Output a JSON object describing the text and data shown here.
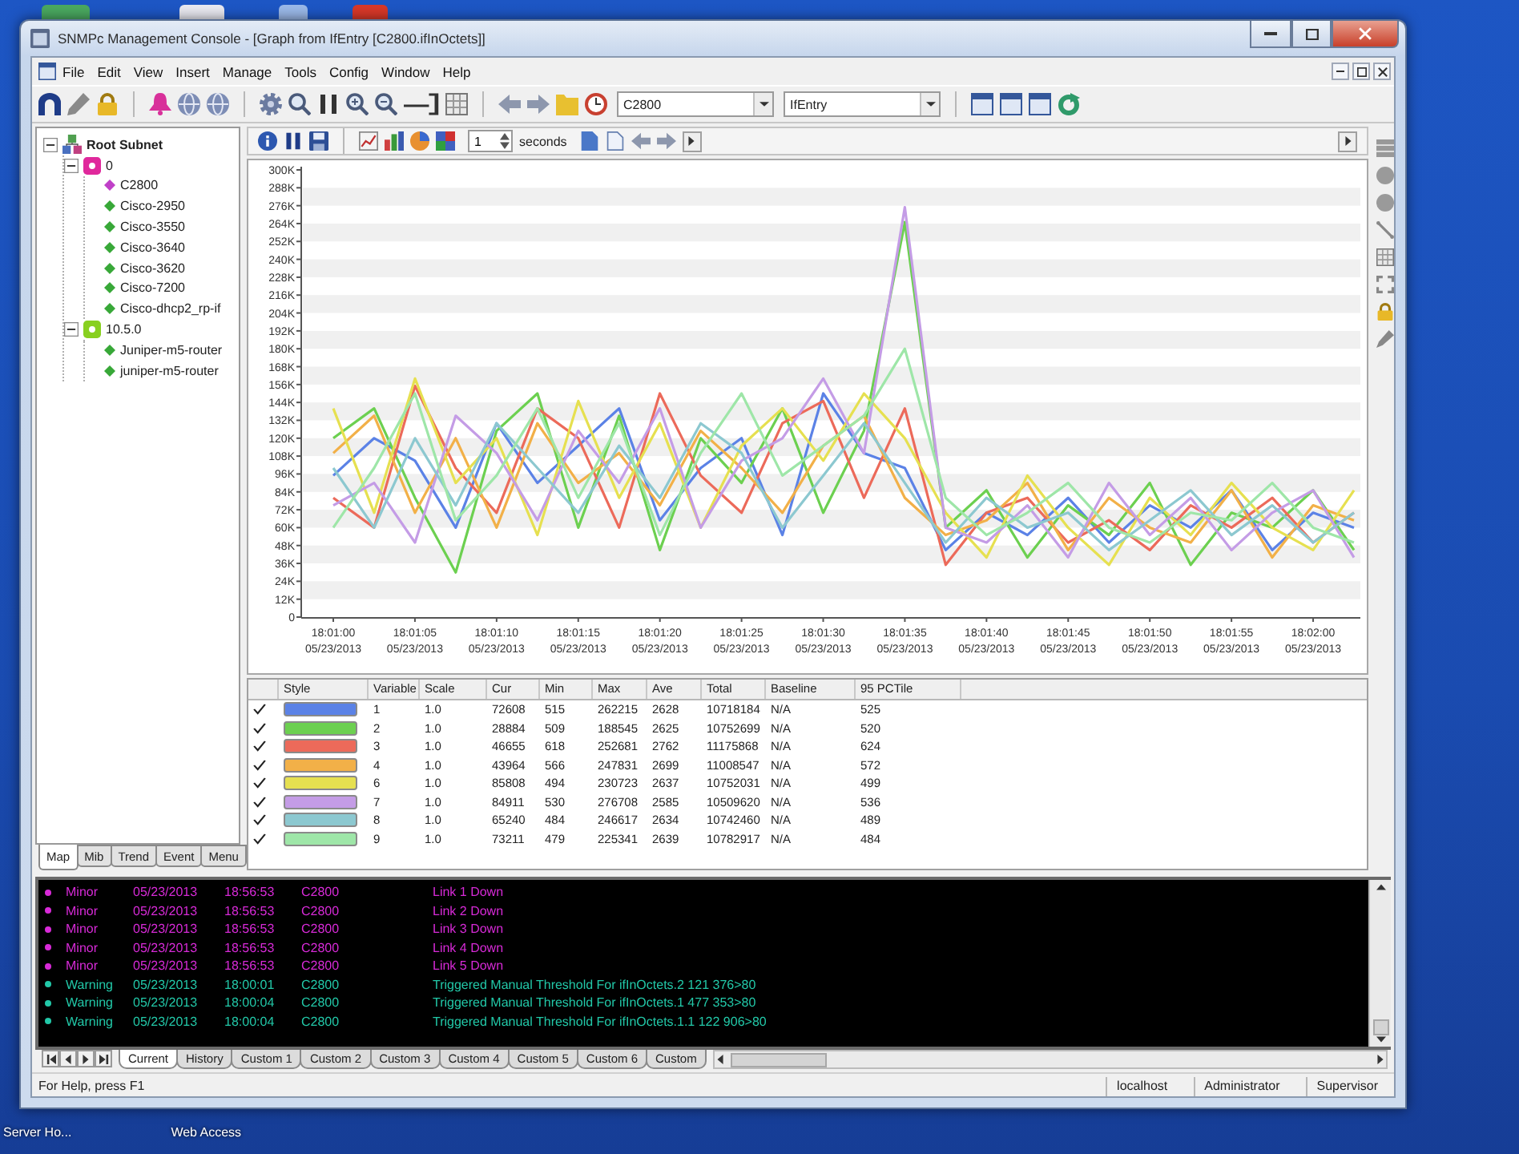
{
  "window": {
    "title": "SNMPc Management Console - [Graph from IfEntry [C2800.ifInOctets]]"
  },
  "menu": [
    "File",
    "Edit",
    "View",
    "Insert",
    "Manage",
    "Tools",
    "Config",
    "Window",
    "Help"
  ],
  "toolbar": {
    "device_combo": "C2800",
    "mib_combo": "IfEntry"
  },
  "tree": {
    "items": [
      {
        "label": "Root Subnet",
        "expanded": true,
        "children": [
          {
            "label": "0",
            "color": "#e0289c",
            "expanded": true,
            "children": [
              {
                "label": "C2800",
                "color": "#c040c8"
              },
              {
                "label": "Cisco-2950",
                "color": "#38a838"
              },
              {
                "label": "Cisco-3550",
                "color": "#38a838"
              },
              {
                "label": "Cisco-3640",
                "color": "#38a838"
              },
              {
                "label": "Cisco-3620",
                "color": "#38a838"
              },
              {
                "label": "Cisco-7200",
                "color": "#38a838"
              },
              {
                "label": "Cisco-dhcp2_rp-if",
                "color": "#38a838"
              }
            ]
          },
          {
            "label": "10.5.0",
            "color": "#88d020",
            "expanded": true,
            "children": [
              {
                "label": "Juniper-m5-router",
                "color": "#38a838"
              },
              {
                "label": "juniper-m5-router",
                "color": "#38a838"
              }
            ]
          }
        ]
      }
    ]
  },
  "left_tabs": [
    {
      "label": "Map",
      "selected": true
    },
    {
      "label": "Mib",
      "selected": false
    },
    {
      "label": "Trend",
      "selected": false
    },
    {
      "label": "Event",
      "selected": false
    },
    {
      "label": "Menu",
      "selected": false
    }
  ],
  "graph": {
    "interval": {
      "value": "1",
      "unit": "seconds"
    },
    "chart_data": {
      "type": "line",
      "ylim": [
        0,
        300
      ],
      "categories": [
        "18:01:00\n05/23/2013",
        null,
        "18:01:05\n05/23/2013",
        null,
        "18:01:10\n05/23/2013",
        null,
        "18:01:15\n05/23/2013",
        null,
        "18:01:20\n05/23/2013",
        null,
        "18:01:25\n05/23/2013",
        null,
        "18:01:30\n05/23/2013",
        null,
        "18:01:35\n05/23/2013",
        null,
        "18:01:40\n05/23/2013",
        null,
        "18:01:45\n05/23/2013",
        null,
        "18:01:50\n05/23/2013",
        null,
        "18:01:55\n05/23/2013",
        null,
        "18:02:00\n05/23/2013",
        null
      ],
      "yticks": [
        0,
        {
          "value": 12,
          "label": "12K"
        },
        {
          "value": 24,
          "label": "24K"
        },
        {
          "value": 36,
          "label": "36K"
        },
        {
          "value": 48,
          "label": "48K"
        },
        {
          "value": 60,
          "label": "60K"
        },
        {
          "value": 72,
          "label": "72K"
        },
        {
          "value": 84,
          "label": "84K"
        },
        {
          "value": 96,
          "label": "96K"
        },
        {
          "value": 108,
          "label": "108K"
        },
        {
          "value": 120,
          "label": "120K"
        },
        {
          "value": 132,
          "label": "132K"
        },
        {
          "value": 144,
          "label": "144K"
        },
        {
          "value": 156,
          "label": "156K"
        },
        {
          "value": 168,
          "label": "168K"
        },
        {
          "value": 180,
          "label": "180K"
        },
        {
          "value": 192,
          "label": "192K"
        },
        {
          "value": 204,
          "label": "204K"
        },
        {
          "value": 216,
          "label": "216K"
        },
        {
          "value": 228,
          "label": "228K"
        },
        {
          "value": 240,
          "label": "240K"
        },
        {
          "value": 252,
          "label": "252K"
        },
        {
          "value": 264,
          "label": "264K"
        },
        {
          "value": 276,
          "label": "276K"
        },
        {
          "value": 288,
          "label": "288K"
        },
        {
          "value": 300,
          "label": "300K"
        }
      ],
      "series": [
        {
          "color": "#5b82e6",
          "values": [
            95,
            120,
            105,
            60,
            130,
            90,
            115,
            140,
            65,
            100,
            120,
            55,
            150,
            110,
            100,
            45,
            70,
            55,
            80,
            50,
            75,
            60,
            85,
            45,
            70,
            60
          ]
        },
        {
          "color": "#6cd050",
          "values": [
            120,
            140,
            80,
            30,
            125,
            150,
            60,
            135,
            45,
            120,
            90,
            140,
            70,
            125,
            265,
            60,
            85,
            40,
            75,
            55,
            90,
            35,
            70,
            60,
            85,
            45
          ]
        },
        {
          "color": "#ec6a5a",
          "values": [
            80,
            60,
            155,
            100,
            70,
            140,
            120,
            60,
            150,
            95,
            70,
            130,
            145,
            80,
            140,
            35,
            70,
            80,
            50,
            65,
            45,
            75,
            60,
            80,
            50,
            70
          ]
        },
        {
          "color": "#f2b048",
          "values": [
            110,
            135,
            70,
            120,
            60,
            130,
            90,
            110,
            75,
            125,
            100,
            70,
            115,
            135,
            80,
            55,
            65,
            90,
            45,
            80,
            60,
            50,
            85,
            40,
            75,
            65
          ]
        },
        {
          "color": "#e6e050",
          "values": [
            140,
            70,
            160,
            90,
            120,
            55,
            145,
            80,
            130,
            60,
            115,
            140,
            105,
            150,
            120,
            70,
            40,
            95,
            60,
            35,
            80,
            55,
            90,
            60,
            45,
            85
          ]
        },
        {
          "color": "#c49ce6",
          "values": [
            75,
            90,
            50,
            135,
            110,
            65,
            125,
            90,
            140,
            60,
            105,
            120,
            160,
            110,
            275,
            60,
            50,
            75,
            40,
            90,
            55,
            80,
            45,
            70,
            85,
            40
          ]
        },
        {
          "color": "#8cc8d0",
          "values": [
            100,
            60,
            120,
            75,
            130,
            100,
            70,
            115,
            80,
            130,
            110,
            60,
            95,
            130,
            90,
            50,
            80,
            60,
            70,
            45,
            65,
            85,
            55,
            75,
            50,
            70
          ]
        },
        {
          "color": "#9ee6a8",
          "values": [
            60,
            100,
            150,
            65,
            95,
            140,
            80,
            130,
            55,
            110,
            150,
            95,
            115,
            135,
            180,
            80,
            55,
            70,
            90,
            60,
            50,
            70,
            65,
            90,
            60,
            50
          ]
        }
      ]
    }
  },
  "variables_table": {
    "columns": [
      "Style",
      "Variable",
      "Scale",
      "Cur",
      "Min",
      "Max",
      "Ave",
      "Total",
      "Baseline",
      "95 PCTile"
    ],
    "rows": [
      {
        "checked": true,
        "color": "#5b82e6",
        "variable": "1",
        "scale": "1.0",
        "cur": "72608",
        "min": "515",
        "max": "262215",
        "ave": "2628",
        "total": "10718184",
        "baseline": "N/A",
        "pctile": "525"
      },
      {
        "checked": true,
        "color": "#6cd050",
        "variable": "2",
        "scale": "1.0",
        "cur": "28884",
        "min": "509",
        "max": "188545",
        "ave": "2625",
        "total": "10752699",
        "baseline": "N/A",
        "pctile": "520"
      },
      {
        "checked": true,
        "color": "#ec6a5a",
        "variable": "3",
        "scale": "1.0",
        "cur": "46655",
        "min": "618",
        "max": "252681",
        "ave": "2762",
        "total": "11175868",
        "baseline": "N/A",
        "pctile": "624"
      },
      {
        "checked": true,
        "color": "#f2b048",
        "variable": "4",
        "scale": "1.0",
        "cur": "43964",
        "min": "566",
        "max": "247831",
        "ave": "2699",
        "total": "11008547",
        "baseline": "N/A",
        "pctile": "572"
      },
      {
        "checked": true,
        "color": "#e6e050",
        "variable": "6",
        "scale": "1.0",
        "cur": "85808",
        "min": "494",
        "max": "230723",
        "ave": "2637",
        "total": "10752031",
        "baseline": "N/A",
        "pctile": "499"
      },
      {
        "checked": true,
        "color": "#c49ce6",
        "variable": "7",
        "scale": "1.0",
        "cur": "84911",
        "min": "530",
        "max": "276708",
        "ave": "2585",
        "total": "10509620",
        "baseline": "N/A",
        "pctile": "536"
      },
      {
        "checked": true,
        "color": "#8cc8d0",
        "variable": "8",
        "scale": "1.0",
        "cur": "65240",
        "min": "484",
        "max": "246617",
        "ave": "2634",
        "total": "10742460",
        "baseline": "N/A",
        "pctile": "489"
      },
      {
        "checked": true,
        "color": "#9ee6a8",
        "variable": "9",
        "scale": "1.0",
        "cur": "73211",
        "min": "479",
        "max": "225341",
        "ave": "2639",
        "total": "10782917",
        "baseline": "N/A",
        "pctile": "484"
      }
    ]
  },
  "event_log": {
    "rows": [
      {
        "severity": "Minor",
        "date": "05/23/2013",
        "time": "18:56:53",
        "device": "C2800",
        "message": "Link 1 Down",
        "color": "#d82ad8"
      },
      {
        "severity": "Minor",
        "date": "05/23/2013",
        "time": "18:56:53",
        "device": "C2800",
        "message": "Link 2 Down",
        "color": "#d82ad8"
      },
      {
        "severity": "Minor",
        "date": "05/23/2013",
        "time": "18:56:53",
        "device": "C2800",
        "message": "Link 3 Down",
        "color": "#d82ad8"
      },
      {
        "severity": "Minor",
        "date": "05/23/2013",
        "time": "18:56:53",
        "device": "C2800",
        "message": "Link 4 Down",
        "color": "#d82ad8"
      },
      {
        "severity": "Minor",
        "date": "05/23/2013",
        "time": "18:56:53",
        "device": "C2800",
        "message": "Link 5 Down",
        "color": "#d82ad8"
      },
      {
        "severity": "Warning",
        "date": "05/23/2013",
        "time": "18:00:01",
        "device": "C2800",
        "message": "Triggered Manual Threshold For ifInOctets.2  121 376>80",
        "color": "#22c8a8"
      },
      {
        "severity": "Warning",
        "date": "05/23/2013",
        "time": "18:00:04",
        "device": "C2800",
        "message": "Triggered Manual Threshold For ifInOctets.1  477 353>80",
        "color": "#22c8a8"
      },
      {
        "severity": "Warning",
        "date": "05/23/2013",
        "time": "18:00:04",
        "device": "C2800",
        "message": "Triggered Manual Threshold For ifInOctets.1.1  122 906>80",
        "color": "#22c8a8"
      }
    ],
    "tabs": [
      {
        "label": "Current",
        "selected": true
      },
      {
        "label": "History",
        "selected": false
      },
      {
        "label": "Custom 1",
        "selected": false
      },
      {
        "label": "Custom 2",
        "selected": false
      },
      {
        "label": "Custom 3",
        "selected": false
      },
      {
        "label": "Custom 4",
        "selected": false
      },
      {
        "label": "Custom 5",
        "selected": false
      },
      {
        "label": "Custom 6",
        "selected": false
      },
      {
        "label": "Custom",
        "selected": false
      }
    ]
  },
  "status_bar": {
    "help": "For Help, press F1",
    "panes": [
      "localhost",
      "Administrator",
      "Supervisor"
    ]
  },
  "desktop": {
    "icons": [
      {
        "label": "Server Ho..."
      },
      {
        "label": "Web Access"
      }
    ]
  }
}
